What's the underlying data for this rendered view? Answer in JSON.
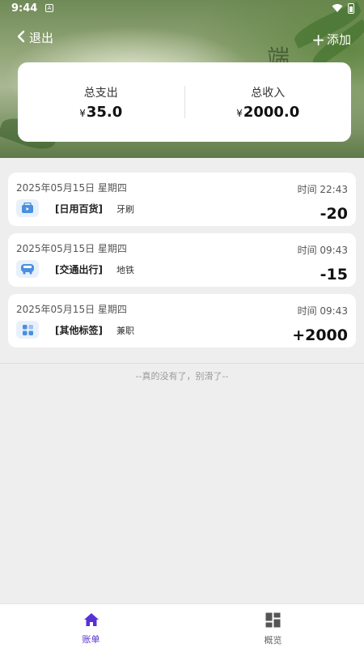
{
  "status": {
    "time": "9:44"
  },
  "nav": {
    "back_label": "退出",
    "add_label": "添加"
  },
  "banner": {
    "brush_text": "端"
  },
  "summary": {
    "expense_label": "总支出",
    "expense_currency": "¥",
    "expense_value": "35.0",
    "income_label": "总收入",
    "income_currency": "¥",
    "income_value": "2000.0"
  },
  "records": [
    {
      "date": "2025年05月15日 星期四",
      "time": "时间 22:43",
      "category": "[日用百货]",
      "note": "牙刷",
      "amount": "-20",
      "icon": "shopping-bag-icon"
    },
    {
      "date": "2025年05月15日 星期四",
      "time": "时间 09:43",
      "category": "[交通出行]",
      "note": "地铁",
      "amount": "-15",
      "icon": "bus-icon"
    },
    {
      "date": "2025年05月15日 星期四",
      "time": "时间 09:43",
      "category": "[其他标签]",
      "note": "兼职",
      "amount": "+2000",
      "icon": "grid-apps-icon"
    }
  ],
  "list_end_text": "--真的没有了，别滑了--",
  "tabs": [
    {
      "label": "账单",
      "icon": "home-icon",
      "active": true
    },
    {
      "label": "概览",
      "icon": "dashboard-icon",
      "active": false
    }
  ],
  "colors": {
    "accent": "#5a2fd6",
    "icon_blue": "#4a8fe0",
    "icon_bg": "#e8f1fb"
  }
}
